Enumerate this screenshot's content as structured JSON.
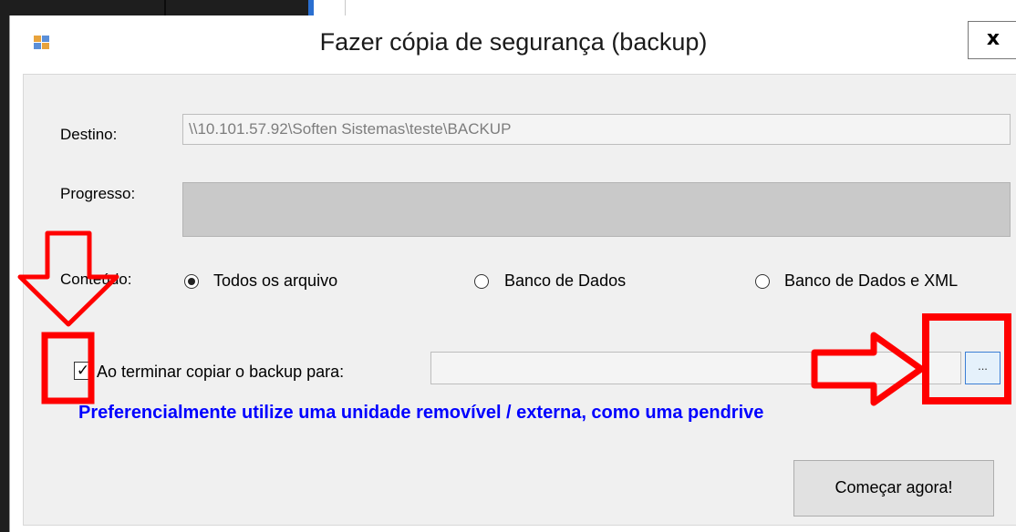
{
  "window": {
    "title": "Fazer cópia de segurança (backup)",
    "close_label": "x"
  },
  "form": {
    "destino_label": "Destino:",
    "destino_value": "\\\\10.101.57.92\\Soften Sistemas\\teste\\BACKUP",
    "progresso_label": "Progresso:",
    "progress_fraction": 0,
    "conteudo_label": "Conteúdo:",
    "radios": [
      {
        "label": "Todos os arquivo",
        "selected": true
      },
      {
        "label": "Banco de Dados",
        "selected": false
      },
      {
        "label": "Banco de Dados e XML",
        "selected": false
      }
    ],
    "copy_checkbox_label": "Ao terminar copiar o backup para:",
    "copy_checkbox_checked": true,
    "copy_path_value": "",
    "browse_label": "...",
    "note": "Preferencialmente utilize uma unidade removível / externa, como uma pendrive",
    "start_label": "Começar agora!"
  },
  "annotation": {
    "color": "#ff0000"
  }
}
